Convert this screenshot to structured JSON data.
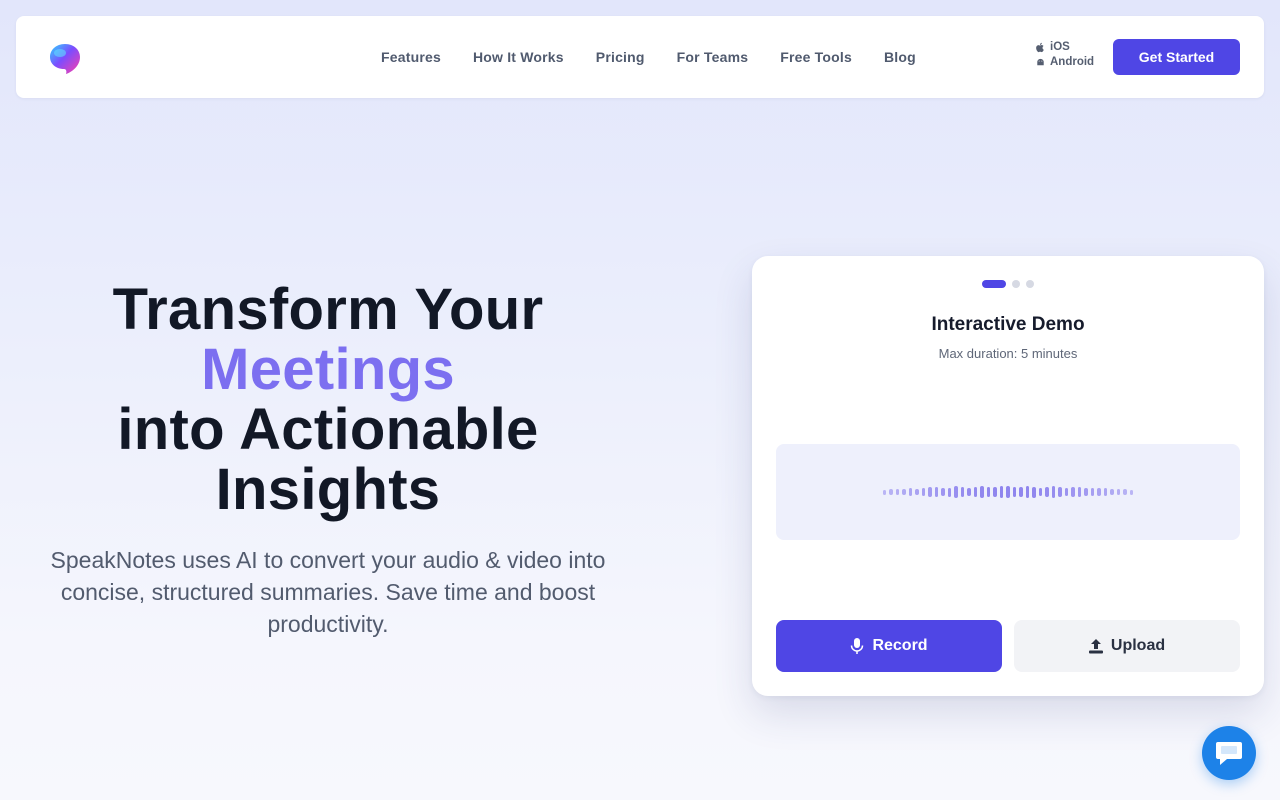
{
  "nav": {
    "logo": "speaknotes-logo",
    "links": [
      "Features",
      "How It Works",
      "Pricing",
      "For Teams",
      "Free Tools",
      "Blog"
    ],
    "stores": [
      {
        "label": "iOS",
        "icon": "apple-icon"
      },
      {
        "label": "Android",
        "icon": "android-icon"
      }
    ],
    "cta_label": "Get Started"
  },
  "hero": {
    "title_line1": "Transform Your",
    "title_accent": "Meetings",
    "title_line3": "into Actionable",
    "title_line4": "Insights",
    "subtitle": "SpeakNotes uses AI to convert your audio & video into concise, structured summaries. Save time and boost productivity."
  },
  "demo": {
    "slides_total": 3,
    "active_slide": 1,
    "title": "Interactive Demo",
    "subtitle": "Max duration: 5 minutes",
    "record_label": "Record",
    "upload_label": "Upload"
  },
  "colors": {
    "primary": "#4f46e5",
    "accent_text": "#7c6ff0",
    "chat": "#1d82e8"
  },
  "chat": {
    "icon": "chat-bubble-icon"
  }
}
